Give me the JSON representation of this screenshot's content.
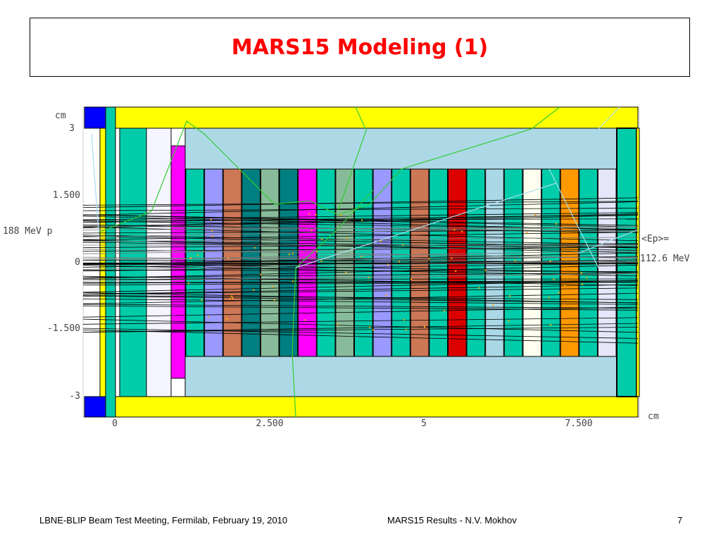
{
  "slide": {
    "title": "MARS15 Modeling (1)",
    "footer_left": "LBNE-BLIP Beam Test Meeting, Fermilab, February 19, 2010",
    "footer_center": "MARS15 Results -  N.V. Mokhov",
    "page_number": "7"
  },
  "diagram": {
    "y_unit": "cm",
    "x_unit": "cm",
    "y_ticks": [
      "3",
      "1.500",
      "0",
      "-1.500",
      "-3"
    ],
    "x_ticks": [
      "0",
      "2.500",
      "5",
      "7.500"
    ],
    "beam_label": "188 MeV p",
    "ep_label_line1": "<Ep>=",
    "ep_label_line2": "112.6 MeV",
    "colors": {
      "frame_yellow": "#ffff00",
      "housing_blue": "#add8e6",
      "teal": "#00ccaa",
      "magenta": "#ff00ff",
      "lavender": "#9999ff",
      "brown": "#cc7755",
      "sage": "#88bb99",
      "dark_teal": "#007f80",
      "red": "#dd0000",
      "light_blue_plate": "#aad8e6",
      "cream": "#fffff0",
      "orange": "#ff9900",
      "pale_lavender": "#e6e6fa",
      "blue": "#0000ff",
      "white_plate": "#f5f5ff"
    },
    "plate_colors": [
      "teal",
      "lavender",
      "brown",
      "dark_teal",
      "sage",
      "dark_teal",
      "magenta",
      "teal",
      "sage",
      "teal",
      "lavender",
      "teal",
      "brown",
      "teal",
      "red",
      "teal",
      "light_blue_plate",
      "teal",
      "cream",
      "teal",
      "orange",
      "teal",
      "pale_lavender"
    ]
  }
}
